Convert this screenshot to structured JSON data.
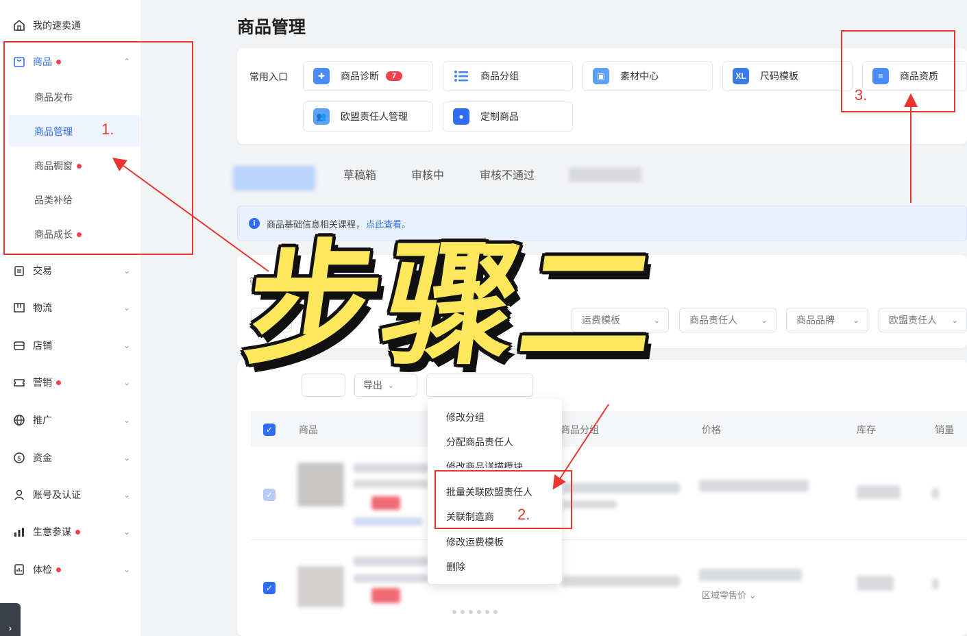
{
  "sidebar": {
    "top_item": "我的速卖通",
    "product_group": "商品",
    "sub_items": [
      "商品发布",
      "商品管理",
      "商品橱窗",
      "品类补给",
      "商品成长"
    ],
    "items": [
      {
        "label": "交易"
      },
      {
        "label": "物流"
      },
      {
        "label": "店铺"
      },
      {
        "label": "营销"
      },
      {
        "label": "推广"
      },
      {
        "label": "资金"
      },
      {
        "label": "账号及认证"
      },
      {
        "label": "生意参谋"
      },
      {
        "label": "体检"
      }
    ],
    "collapse_glyph": "›"
  },
  "page": {
    "title": "商品管理"
  },
  "quick_entries": {
    "label": "常用入口",
    "items": [
      "商品诊断",
      "商品分组",
      "素材中心",
      "尺码模板",
      "商品资质",
      "欧盟责任人管理",
      "定制商品"
    ],
    "diagnosis_badge": "7"
  },
  "tabs": [
    "草稿箱",
    "审核中",
    "审核不通过"
  ],
  "info_bar": {
    "text": "商品基础信息相关课程，",
    "link": "点此查看。"
  },
  "filter": {
    "label": "筛选",
    "selects": [
      "运费模板",
      "商品责任人",
      "商品品牌",
      "欧盟责任人"
    ]
  },
  "toolbar": {
    "export_label": "导出"
  },
  "table": {
    "headers": [
      "商品",
      "商品分组",
      "价格",
      "库存",
      "销量"
    ],
    "row_price_label": "区域零售价"
  },
  "batch_menu": {
    "items": [
      "修改分组",
      "分配商品责任人",
      "修改商品详描模块",
      "批量关联欧盟责任人",
      "关联制造商",
      "修改运费模板",
      "删除"
    ]
  },
  "annotations": {
    "num1": "1.",
    "num2": "2.",
    "num3": "3.",
    "overlay_title": "步骤二",
    "color": "#e8352f"
  }
}
